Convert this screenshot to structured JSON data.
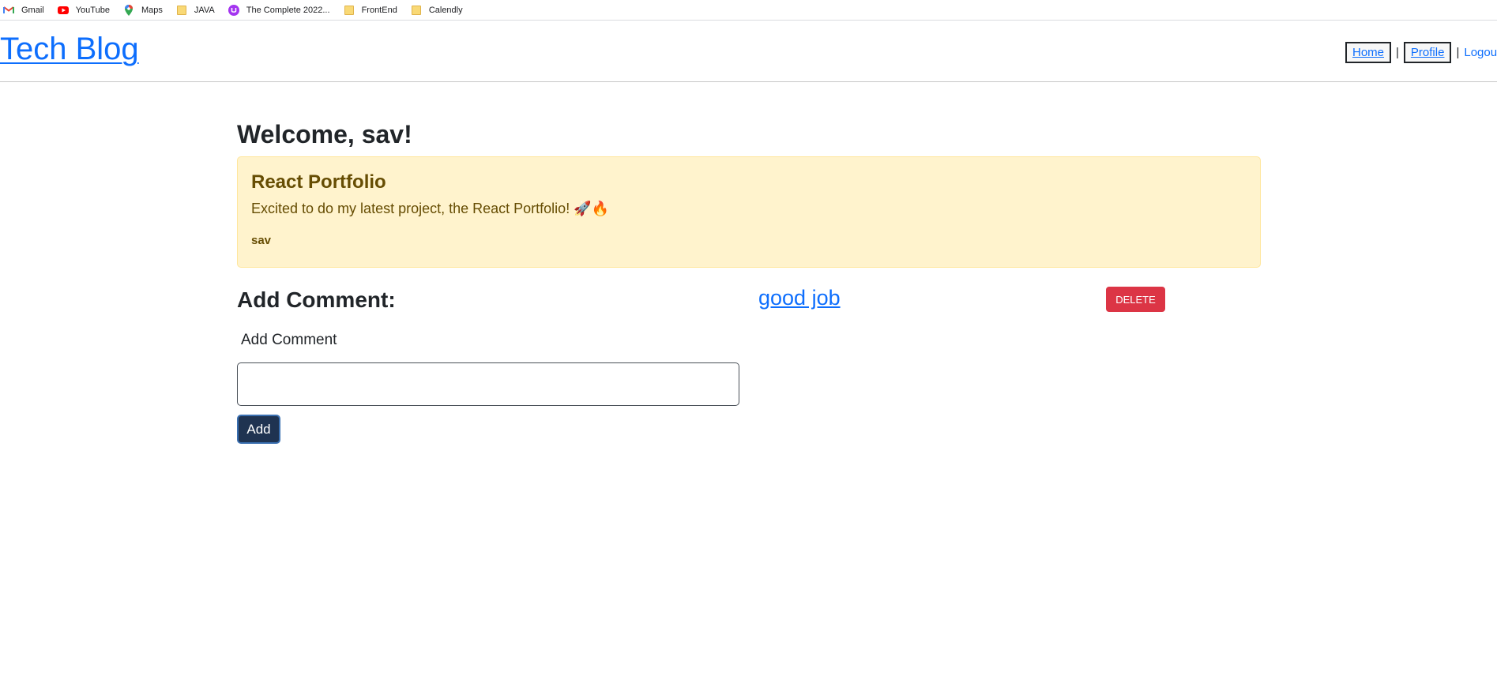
{
  "bookmarks": [
    {
      "label": "Gmail",
      "icon": "gmail-icon"
    },
    {
      "label": "YouTube",
      "icon": "youtube-icon"
    },
    {
      "label": "Maps",
      "icon": "maps-icon"
    },
    {
      "label": "JAVA",
      "icon": "folder-icon"
    },
    {
      "label": "The Complete 2022...",
      "icon": "udemy-icon"
    },
    {
      "label": "FrontEnd",
      "icon": "folder-icon"
    },
    {
      "label": "Calendly",
      "icon": "folder-icon"
    }
  ],
  "header": {
    "brand": "Tech Blog",
    "nav": {
      "home": "Home",
      "separator": "|",
      "profile": "Profile",
      "logout": "Logou"
    }
  },
  "main": {
    "welcome": "Welcome, sav!",
    "post": {
      "title": "React Portfolio",
      "body": "Excited to do my latest project, the React Portfolio! 🚀🔥",
      "author": "sav"
    },
    "add_comment": {
      "heading": "Add Comment:",
      "label": "Add Comment",
      "input_value": "",
      "button": "Add"
    },
    "comments": [
      {
        "text": "good job",
        "delete_label": "DELETE"
      }
    ]
  },
  "colors": {
    "link": "#0d6efd",
    "card_bg": "#fff3cd",
    "card_text": "#664d03",
    "add_button": "#1f3351",
    "delete_button": "#dc3545"
  }
}
